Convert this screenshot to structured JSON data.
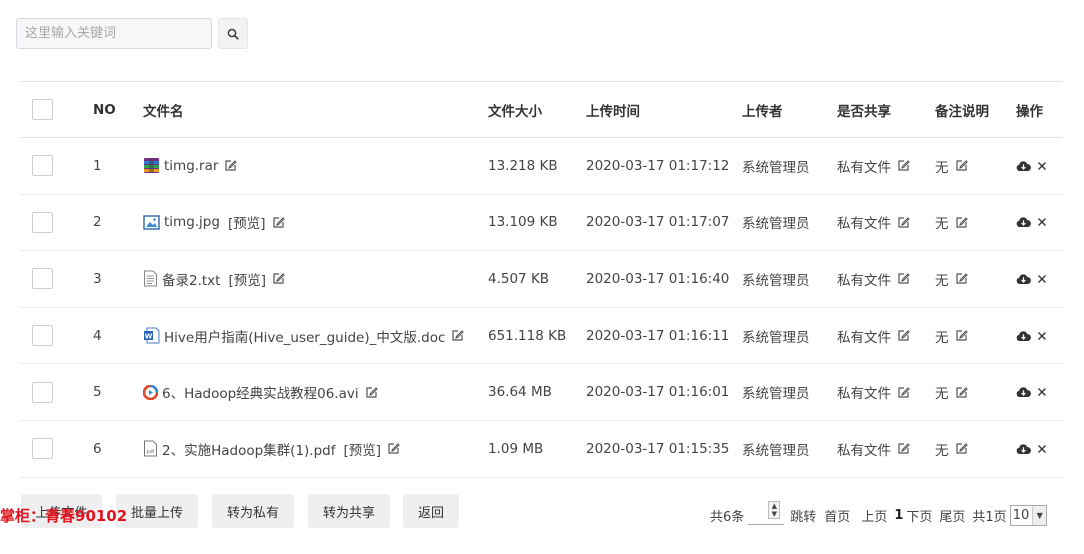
{
  "search": {
    "placeholder": "这里输入关键词",
    "icon": "search-icon"
  },
  "table": {
    "columns": {
      "no": "NO",
      "filename": "文件名",
      "size": "文件大小",
      "time": "上传时间",
      "uploader": "上传者",
      "shared": "是否共享",
      "note": "备注说明",
      "ops": "操作"
    },
    "rows": [
      {
        "no": "1",
        "name": "timg.rar",
        "icon": "rar-file-icon",
        "preview": "",
        "size": "13.218 KB",
        "time": "2020-03-17 01:17:12",
        "uploader": "系统管理员",
        "shared": "私有文件",
        "note": "无"
      },
      {
        "no": "2",
        "name": "timg.jpg",
        "icon": "image-file-icon",
        "preview": "[预览]",
        "size": "13.109 KB",
        "time": "2020-03-17 01:17:07",
        "uploader": "系统管理员",
        "shared": "私有文件",
        "note": "无"
      },
      {
        "no": "3",
        "name": "备录2.txt",
        "icon": "text-file-icon",
        "preview": "[预览]",
        "size": "4.507 KB",
        "time": "2020-03-17 01:16:40",
        "uploader": "系统管理员",
        "shared": "私有文件",
        "note": "无"
      },
      {
        "no": "4",
        "name": "Hive用户指南(Hive_user_guide)_中文版.doc",
        "icon": "word-file-icon",
        "preview": "",
        "size": "651.118 KB",
        "time": "2020-03-17 01:16:11",
        "uploader": "系统管理员",
        "shared": "私有文件",
        "note": "无"
      },
      {
        "no": "5",
        "name": "6、Hadoop经典实战教程06.avi",
        "icon": "video-file-icon",
        "preview": "",
        "size": "36.64 MB",
        "time": "2020-03-17 01:16:01",
        "uploader": "系统管理员",
        "shared": "私有文件",
        "note": "无"
      },
      {
        "no": "6",
        "name": "2、实施Hadoop集群(1).pdf",
        "icon": "pdf-file-icon",
        "preview": "[预览]",
        "size": "1.09 MB",
        "time": "2020-03-17 01:15:35",
        "uploader": "系统管理员",
        "shared": "私有文件",
        "note": "无"
      }
    ]
  },
  "actions": {
    "upload": "上传文件",
    "batch_upload": "批量上传",
    "make_private": "转为私有",
    "make_shared": "转为共享",
    "back": "返回"
  },
  "watermark": "掌柜：青春90102",
  "pager": {
    "total": "共6条",
    "jump": "跳转",
    "first": "首页",
    "prev": "上页",
    "current": "1",
    "next": "下页",
    "last": "尾页",
    "pages": "共1页",
    "page_size": "10"
  },
  "colors": {
    "watermark": "#e0141e",
    "border": "#e5e5e5",
    "button_bg": "#efefef"
  }
}
